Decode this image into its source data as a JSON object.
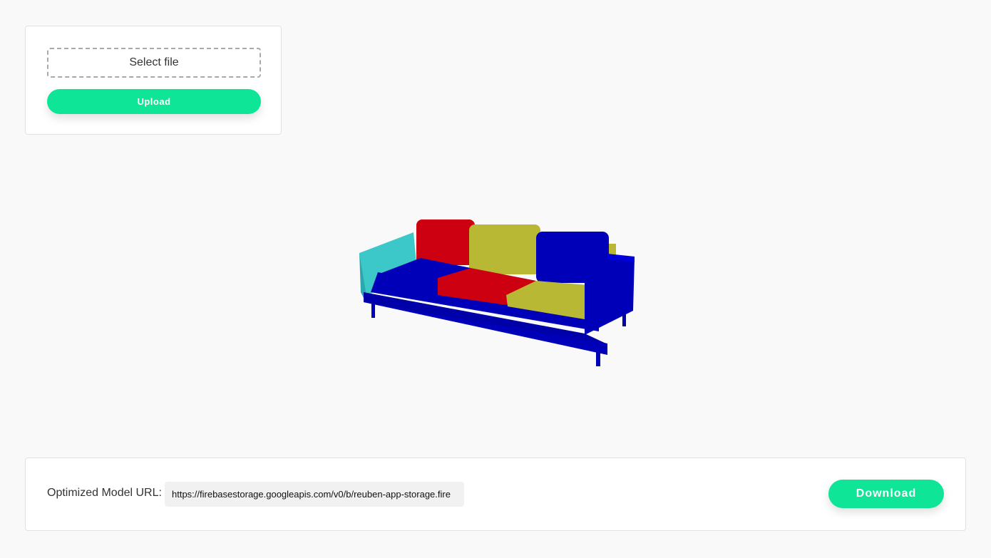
{
  "upload": {
    "select_label": "Select file",
    "upload_label": "Upload"
  },
  "result": {
    "url_label": "Optimized Model URL:",
    "url_value": "https://firebasestorage.googleapis.com/v0/b/reuben-app-storage.fire",
    "download_label": "Download"
  },
  "colors": {
    "accent": "#0ee596",
    "sofa_red": "#cc0011",
    "sofa_yellow": "#b8b834",
    "sofa_blue": "#0000b8",
    "sofa_cyan": "#3cc8c8"
  },
  "viewer": {
    "model": "sofa"
  }
}
